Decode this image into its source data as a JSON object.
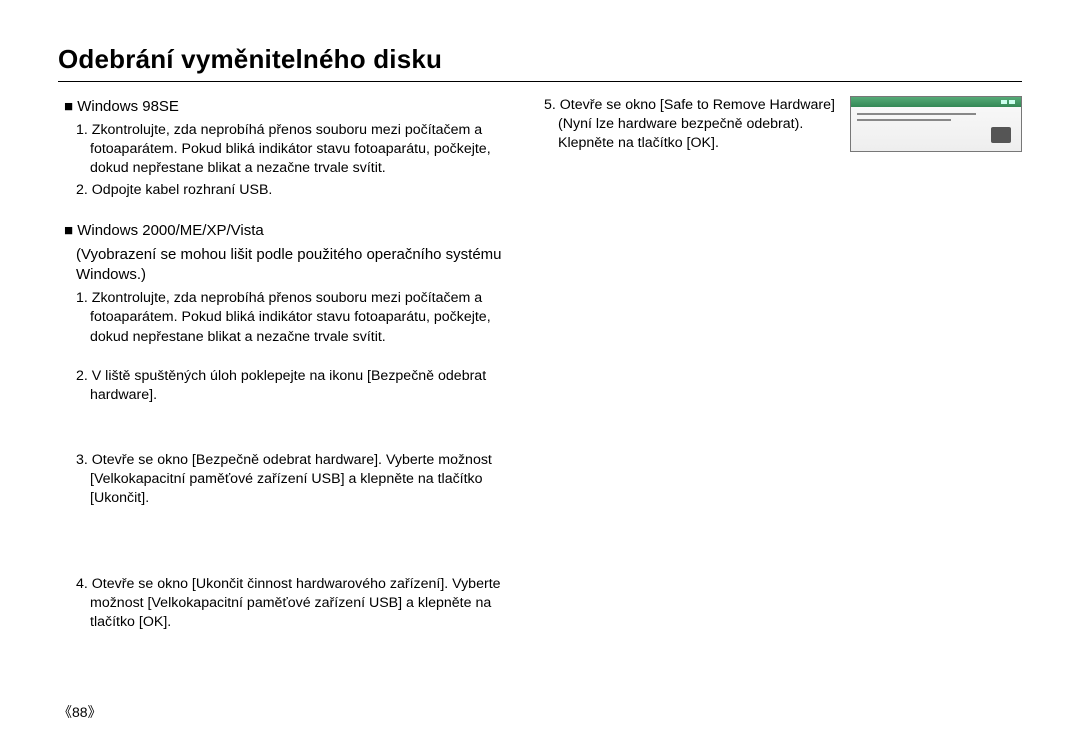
{
  "title": "Odebrání vyměnitelného disku",
  "left": {
    "sec98_head": "■ Windows 98SE",
    "sec98_step1": "1. Zkontrolujte, zda neprobíhá přenos souboru mezi počítačem a fotoaparátem. Pokud bliká indikátor stavu fotoaparátu, počkejte, dokud nepřestane blikat a nezačne trvale svítit.",
    "sec98_step2": "2. Odpojte kabel rozhraní USB.",
    "sec2k_head": "■ Windows 2000/ME/XP/Vista",
    "sec2k_sub": "(Vyobrazení se mohou lišit podle použitého operačního systému Windows.)",
    "sec2k_step1": "1. Zkontrolujte, zda neprobíhá přenos souboru mezi počítačem a fotoaparátem. Pokud bliká indikátor stavu fotoaparátu, počkejte, dokud nepřestane blikat a nezačne trvale svítit.",
    "sec2k_step2": "2. V liště spuštěných úloh poklepejte na ikonu [Bezpečně odebrat hardware].",
    "sec2k_step3": "3. Otevře se okno [Bezpečně odebrat hardware]. Vyberte možnost [Velkokapacitní paměťové zařízení USB] a klepněte na tlačítko [Ukončit].",
    "sec2k_step4": "4. Otevře se okno [Ukončit činnost hardwarového zařízení]. Vyberte možnost [Velkokapacitní paměťové zařízení USB] a klepněte na tlačítko [OK]."
  },
  "right": {
    "step5": "5. Otevře se okno [Safe to Remove Hardware] (Nyní lze hardware bezpečně odebrat). Klepněte na tlačítko [OK]."
  },
  "page_number": "《88》"
}
